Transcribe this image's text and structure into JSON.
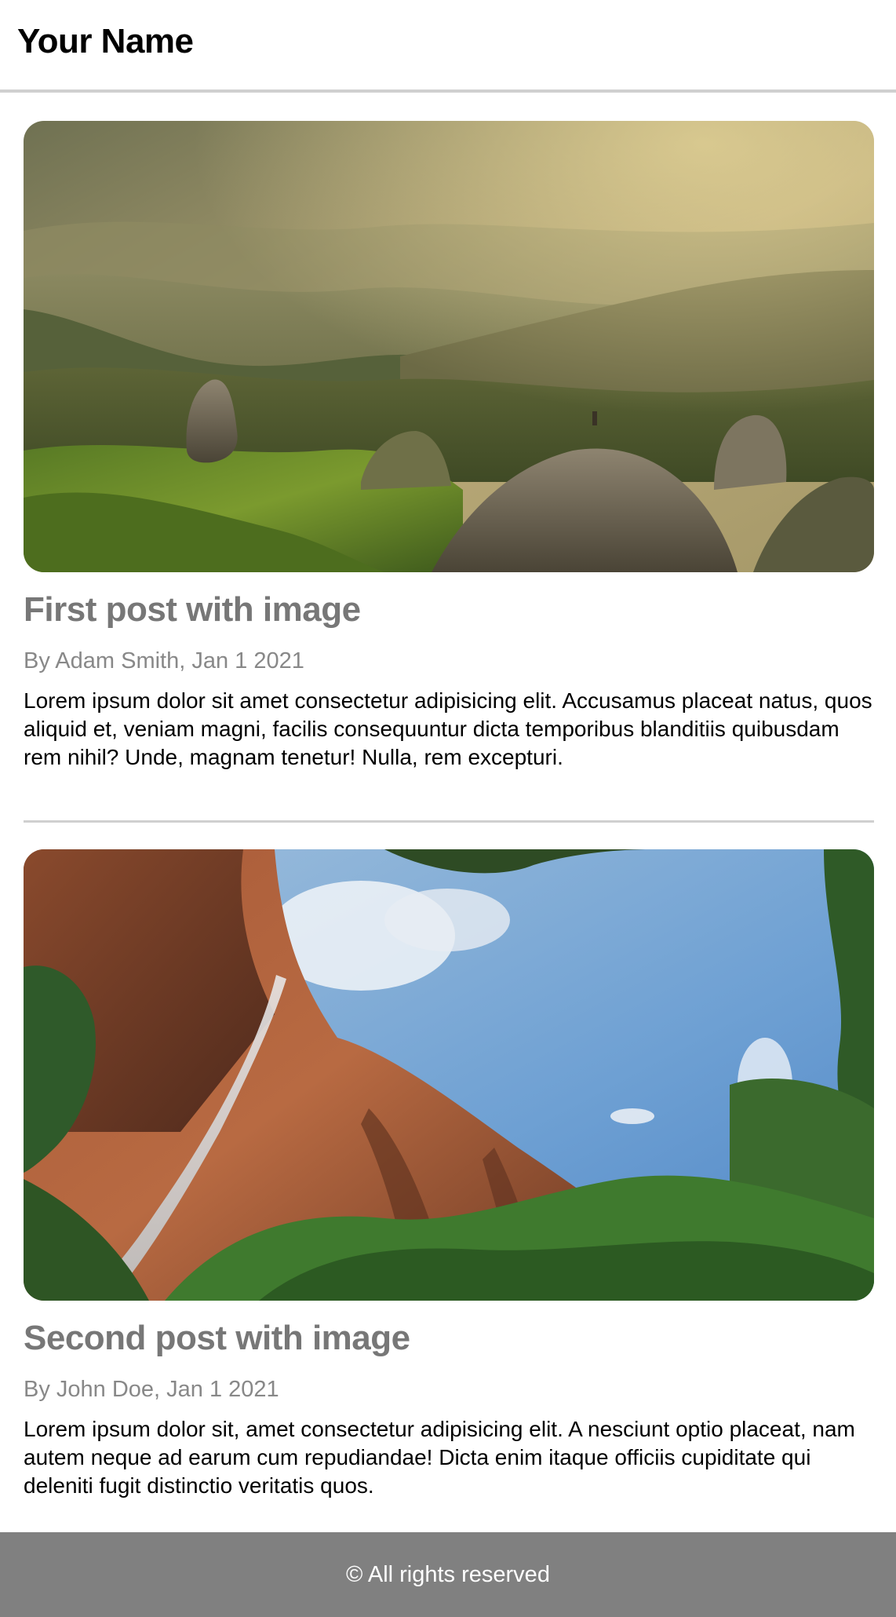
{
  "header": {
    "site_title": "Your Name"
  },
  "posts": [
    {
      "image_icon": "mountain-landscape-photo",
      "title": "First post with image",
      "meta": "By Adam Smith, Jan 1 2021",
      "body": "Lorem ipsum dolor sit amet consectetur adipisicing elit. Accusamus placeat natus, quos aliquid et, veniam magni, facilis consequuntur dicta temporibus blanditiis quibusdam rem nihil? Unde, magnam tenetur! Nulla, rem excepturi."
    },
    {
      "image_icon": "canyon-waterfall-photo",
      "title": "Second post with image",
      "meta": "By John Doe, Jan 1 2021",
      "body": "Lorem ipsum dolor sit, amet consectetur adipisicing elit. A nesciunt optio placeat, nam autem neque ad earum cum repudiandae! Dicta enim itaque officiis cupiditate qui deleniti fugit distinctio veritatis quos."
    }
  ],
  "footer": {
    "text": "© All rights reserved"
  },
  "colors": {
    "header_border": "#d0d0d0",
    "post_title": "#777777",
    "post_meta": "#888888",
    "footer_bg": "#808080",
    "footer_text": "#ffffff"
  }
}
